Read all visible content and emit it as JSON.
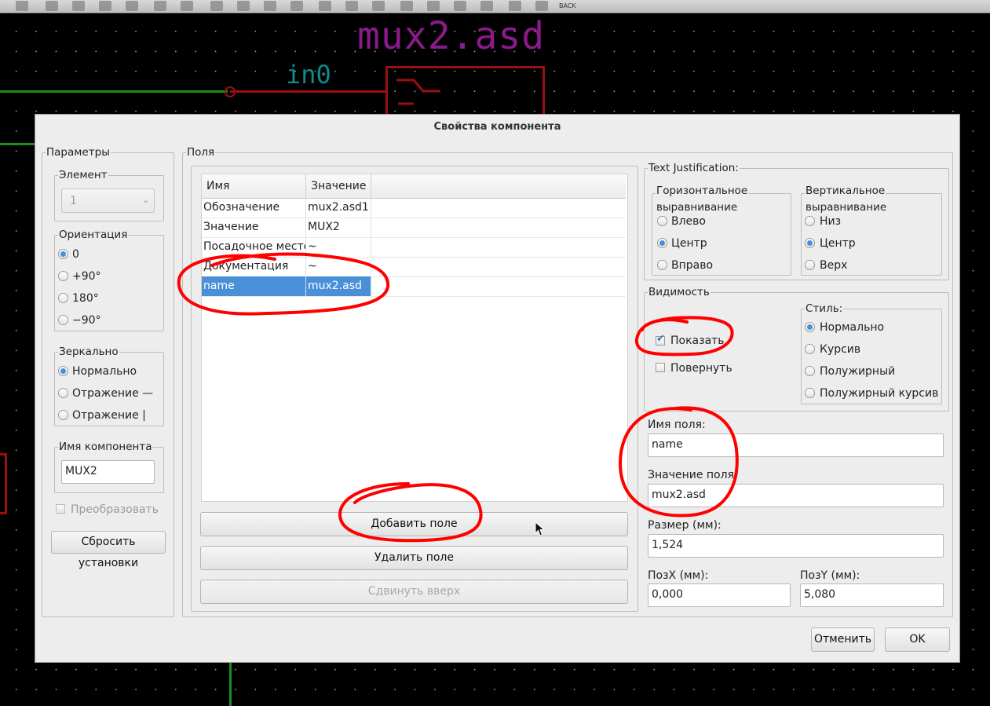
{
  "toolbar": {
    "back_label": "BACK",
    "icons": [
      "undo-icon",
      "new-icon",
      "open-icon",
      "save-icon",
      "redo-icon",
      "print-icon",
      "edit-icon",
      "zoom-in-icon",
      "zoom-out-icon",
      "zoom-fit-icon",
      "netlist-icon",
      "annotate-icon",
      "erc-icon",
      "bom-icon",
      "cvpcb-icon",
      "pcb-icon",
      "settings-icon",
      "library-icon",
      "back-icon"
    ]
  },
  "schematic": {
    "component_title": "mux2.asd",
    "pin_label": "in0"
  },
  "dialog": {
    "title": "Свойства компонента",
    "params": {
      "title": "Параметры",
      "unit_group": "Элемент",
      "unit_value": "1",
      "orientation_group": "Ориентация",
      "orientation_options": [
        "0",
        "+90°",
        "180°",
        "−90°"
      ],
      "orientation_selected": "0",
      "mirror_group": "Зеркально",
      "mirror_options": [
        "Нормально",
        "Отражение —",
        "Отражение |"
      ],
      "mirror_selected": "Нормально",
      "name_group": "Имя компонента",
      "name_value": "MUX2",
      "convert_label": "Преобразовать",
      "reset_button": "Сбросить установки"
    },
    "fields": {
      "title": "Поля",
      "columns": [
        "Имя",
        "Значение"
      ],
      "rows": [
        {
          "name": "Обозначение",
          "value": "mux2.asd1"
        },
        {
          "name": "Значение",
          "value": "MUX2"
        },
        {
          "name": "Посадочное место",
          "value": "~"
        },
        {
          "name": "Документация",
          "value": "~"
        },
        {
          "name": "name",
          "value": "mux2.asd"
        }
      ],
      "selected_row": "name",
      "add_button": "Добавить поле",
      "delete_button": "Удалить поле",
      "move_up_button": "Сдвинуть вверх"
    },
    "justification": {
      "title": "Text Justification:",
      "horizontal_title_line1": "Горизонтальное",
      "horizontal_title_line2": "выравнивание",
      "horizontal_options": [
        "Влево",
        "Центр",
        "Вправо"
      ],
      "horizontal_selected": "Центр",
      "vertical_title_line1": "Вертикальное",
      "vertical_title_line2": "выравнивание",
      "vertical_options": [
        "Низ",
        "Центр",
        "Верх"
      ],
      "vertical_selected": "Центр"
    },
    "visibility": {
      "title": "Видимость",
      "show_label": "Показать",
      "show_checked": true,
      "rotate_label": "Повернуть",
      "rotate_checked": false,
      "style_title": "Стиль:",
      "style_options": [
        "Нормально",
        "Курсив",
        "Полужирный",
        "Полужирный курсив"
      ],
      "style_selected": "Нормально"
    },
    "field_props": {
      "name_label": "Имя поля:",
      "name_value": "name",
      "value_label": "Значение поля",
      "value_value": "mux2.asd",
      "size_label": "Размер (мм):",
      "size_value": "1,524",
      "posx_label": "ПозX (мм):",
      "posx_value": "0,000",
      "posy_label": "ПозY (мм):",
      "posy_value": "5,080"
    },
    "cancel_button": "Отменить",
    "ok_button": "OK"
  },
  "colors": {
    "selection": "#4a90d9",
    "annotation": "#ff0000",
    "wire": "#1e8c1e",
    "component_title": "#8b1a8b",
    "pin_label": "#108a8a"
  }
}
